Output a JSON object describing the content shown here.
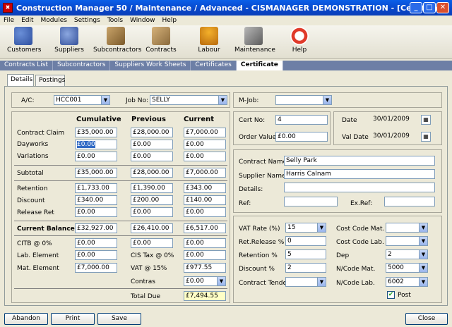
{
  "window": {
    "title": "Construction Manager 50 / Maintenance / Advanced  - CISMANAGER  DEMONSTRATION - [Certificate]"
  },
  "menu": [
    "File",
    "Edit",
    "Modules",
    "Settings",
    "Tools",
    "Window",
    "Help"
  ],
  "toolbar": [
    "Customers",
    "Suppliers",
    "Subcontractors",
    "Contracts",
    "Labour",
    "Maintenance",
    "Help"
  ],
  "top_tabs": [
    "Contracts List",
    "Subcontractors",
    "Suppliers Work Sheets",
    "Certificates",
    "Certificate"
  ],
  "sub_tabs": [
    "Details",
    "Postings"
  ],
  "header": {
    "ac_label": "A/C:",
    "ac_value": "HCC001",
    "job_label": "Job No:",
    "job_value": "SELLY",
    "mjob_label": "M-Job:",
    "mjob_value": ""
  },
  "grid": {
    "col_cumulative": "Cumulative",
    "col_previous": "Previous",
    "col_current": "Current",
    "contract_claim": {
      "label": "Contract Claim",
      "cum": "£35,000.00",
      "prev": "£28,000.00",
      "cur": "£7,000.00"
    },
    "dayworks": {
      "label": "Dayworks",
      "cum": "£0.00",
      "prev": "£0.00",
      "cur": "£0.00"
    },
    "variations": {
      "label": "Variations",
      "cum": "£0.00",
      "prev": "£0.00",
      "cur": "£0.00"
    },
    "subtotal": {
      "label": "Subtotal",
      "cum": "£35,000.00",
      "prev": "£28,000.00",
      "cur": "£7,000.00"
    },
    "retention": {
      "label": "Retention",
      "cum": "£1,733.00",
      "prev": "£1,390.00",
      "cur": "£343.00"
    },
    "discount": {
      "label": "Discount",
      "cum": "£340.00",
      "prev": "£200.00",
      "cur": "£140.00"
    },
    "release_ret": {
      "label": "Release Ret",
      "cum": "£0.00",
      "prev": "£0.00",
      "cur": "£0.00"
    },
    "current_balance": {
      "label": "Current Balance",
      "cum": "£32,927.00",
      "prev": "£26,410.00",
      "cur": "£6,517.00"
    },
    "citb": {
      "label": "CITB @ 0%",
      "cum": "£0.00",
      "prev": "£0.00",
      "cur": "£0.00"
    },
    "lab_element": {
      "label": "Lab. Element",
      "cum": "£0.00",
      "extra_label": "CIS Tax @ 0%",
      "extra_value": "£0.00"
    },
    "mat_element": {
      "label": "Mat. Element",
      "cum": "£7,000.00",
      "extra_label": "VAT @ 15%",
      "extra_value": "£977.55"
    },
    "contras": {
      "label": "Contras",
      "value": "£0.00"
    },
    "total_due": {
      "label": "Total Due",
      "value": "£7,494.55"
    }
  },
  "cert": {
    "cert_no_label": "Cert No:",
    "cert_no": "4",
    "date_label": "Date",
    "date": "30/01/2009",
    "order_value_label": "Order Value",
    "order_value": "£0.00",
    "val_date_label": "Val Date",
    "val_date": "30/01/2009"
  },
  "contract": {
    "name_label": "Contract Name:",
    "name": "Selly Park",
    "supplier_label": "Supplier Name:",
    "supplier": "Harris Calnam",
    "details_label": "Details:",
    "details": "",
    "ref_label": "Ref:",
    "ref": "",
    "exref_label": "Ex.Ref:",
    "exref": ""
  },
  "rates": {
    "vat_label": "VAT Rate (%)",
    "vat": "15",
    "ret_release_label": "Ret.Release %",
    "ret_release": "0",
    "retention_label": "Retention %",
    "retention": "5",
    "discount_label": "Discount %",
    "discount": "2",
    "tender_label": "Contract Tender",
    "tender": "",
    "ccmat_label": "Cost Code Mat.",
    "ccmat": "",
    "cclab_label": "Cost Code Lab.",
    "cclab": "",
    "dep_label": "Dep",
    "dep": "2",
    "ncmat_label": "N/Code Mat.",
    "ncmat": "5000",
    "nclab_label": "N/Code Lab.",
    "nclab": "6002",
    "post_label": "Post",
    "post_checked": true
  },
  "buttons": {
    "abandon": "Abandon",
    "print": "Print",
    "save": "Save",
    "close": "Close"
  },
  "colors": {
    "title": "#0A5FE8",
    "tab_bar": "#6D7FA6",
    "selected": "#316AC5",
    "total_due_bg": "#FFFFC6"
  }
}
